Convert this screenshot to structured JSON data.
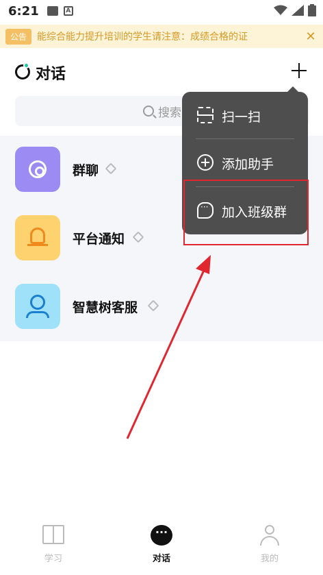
{
  "status_bar": {
    "time": "6:21",
    "app_icon_letter": "A"
  },
  "notice": {
    "badge": "公告",
    "text": "能综合能力提升培训的学生请注意：成绩合格的证",
    "close": "✕"
  },
  "header": {
    "title": "对话"
  },
  "search": {
    "placeholder": "搜索"
  },
  "conversations": [
    {
      "name": "群聊",
      "icon": "group-chat-icon"
    },
    {
      "name": "平台通知",
      "icon": "bell-icon"
    },
    {
      "name": "智慧树客服",
      "icon": "customer-service-icon"
    }
  ],
  "popup_menu": {
    "items": [
      {
        "label": "扫一扫",
        "icon": "scan-icon"
      },
      {
        "label": "添加助手",
        "icon": "plus-circle-icon"
      },
      {
        "label": "加入班级群",
        "icon": "chat-group-icon"
      }
    ]
  },
  "tabbar": {
    "tabs": [
      {
        "label": "学习",
        "icon": "book-icon",
        "active": false
      },
      {
        "label": "对话",
        "icon": "chat-icon",
        "active": true
      },
      {
        "label": "我的",
        "icon": "user-icon",
        "active": false
      }
    ]
  },
  "colors": {
    "notice_bg": "#fdf3d6",
    "notice_text": "#d69a26",
    "popup_bg": "#4e4e4e",
    "highlight": "#e0272f",
    "accent_dot": "#19c9a4"
  }
}
